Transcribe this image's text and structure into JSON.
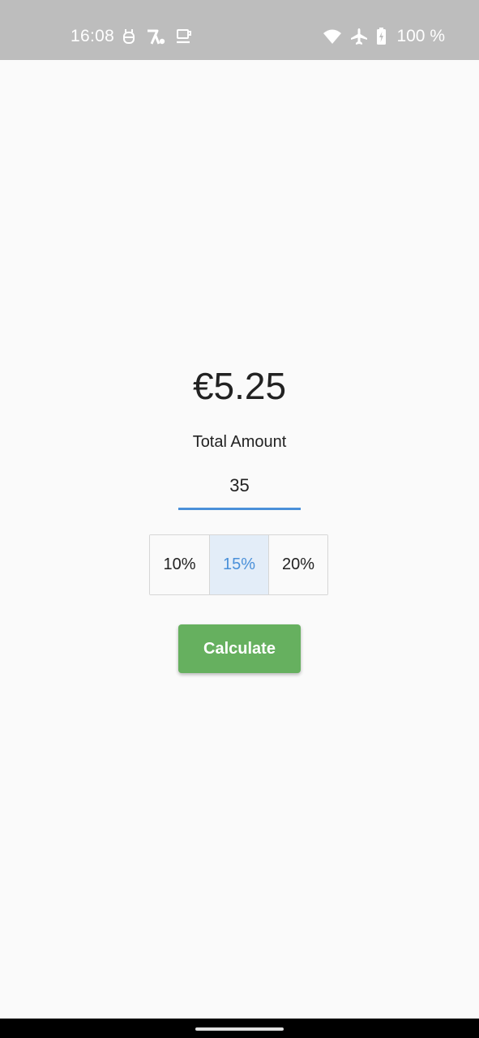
{
  "status_bar": {
    "time": "16:08",
    "left_icons": [
      "usb-debug-icon",
      "app-notification-icon",
      "coffee-icon"
    ],
    "right_icons": [
      "wifi-icon",
      "airplane-mode-icon",
      "battery-charging-icon"
    ],
    "battery_text": "100 %",
    "background_color": "#bdbdbd"
  },
  "calculator": {
    "tip_result": "€5.25",
    "total_label": "Total Amount",
    "amount_value": "35",
    "percent_options": [
      "10%",
      "15%",
      "20%"
    ],
    "selected_percent": "15%",
    "calculate_label": "Calculate"
  },
  "colors": {
    "accent": "#4a90d9",
    "button_green": "#66b05f",
    "selected_bg": "#e3edf8",
    "page_bg": "#fafafa"
  }
}
